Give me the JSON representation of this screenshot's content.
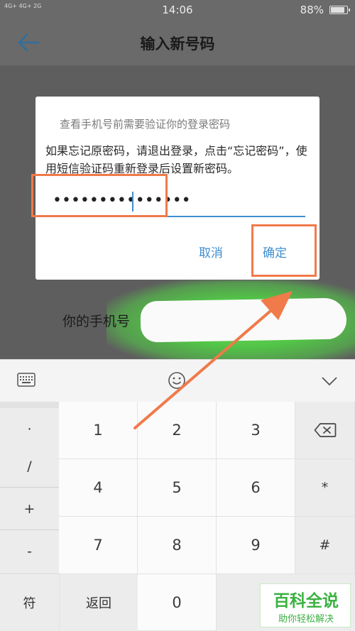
{
  "status_bar": {
    "signal_text": "4G+ 4G+ 2G",
    "time": "14:06",
    "battery": "88%"
  },
  "header": {
    "title": "输入新号码"
  },
  "page": {
    "phone_label": "你的手机号"
  },
  "dialog": {
    "title": "查看手机号前需要验证你的登录密码",
    "message": "如果忘记原密码，请退出登录，点击“忘记密码”，使用短信验证码重新登录后设置新密码。",
    "password_value": "•••••••••••••••",
    "cancel_label": "取消",
    "confirm_label": "确定"
  },
  "keyboard": {
    "symbols": [
      "·",
      "/",
      "+",
      "-"
    ],
    "digits": [
      [
        "1",
        "2",
        "3"
      ],
      [
        "4",
        "5",
        "6"
      ],
      [
        "7",
        "8",
        "9"
      ]
    ],
    "right_keys": [
      "*",
      "#"
    ],
    "bottom": {
      "symbol_key": "符",
      "back_key": "返回",
      "zero": "0"
    }
  },
  "watermark": {
    "main": "百科全说",
    "sub": "助你轻松解决"
  },
  "colors": {
    "accent": "#3e8ed0",
    "annotation": "#f07a4a",
    "glow": "#52c447"
  }
}
